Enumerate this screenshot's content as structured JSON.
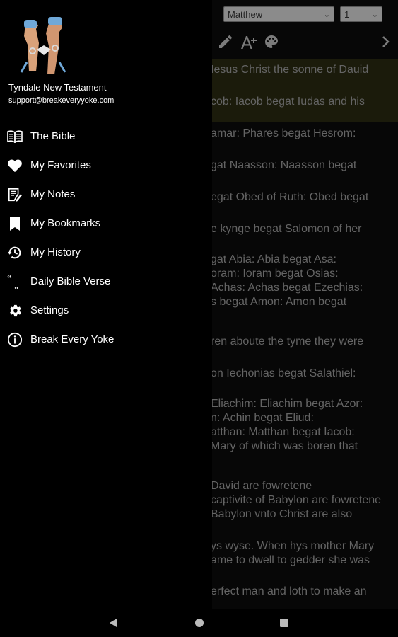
{
  "reader": {
    "book_selected": "Matthew",
    "chapter_selected": "1",
    "verses": [
      {
        "lines": [
          "Iesus Christ the sonne of Dauid"
        ]
      },
      {
        "lines": [
          "cob: Iacob begat Iudas and his"
        ]
      },
      {
        "lines": [
          "amar: Phares begat Hesrom:"
        ]
      },
      {
        "lines": [
          "gat Naasson: Naasson begat"
        ]
      },
      {
        "lines": [
          "egat Obed of Ruth: Obed begat"
        ]
      },
      {
        "lines": [
          "e kynge begat Salomon of her"
        ]
      },
      {
        "lines": [
          "gat Abia: Abia begat Asa:",
          "oram: Ioram begat Osias:",
          "Achas: Achas begat Ezechias:",
          "s begat Amon: Amon begat"
        ]
      },
      {
        "lines": [
          "ren aboute the tyme they were"
        ]
      },
      {
        "lines": [
          "on Iechonias begat Salathiel:"
        ]
      },
      {
        "lines": [
          "Eliachim: Eliachim begat Azor:",
          "n: Achin begat Eliud:",
          "atthan: Matthan begat Iacob:",
          "Mary of which was boren that"
        ]
      },
      {
        "lines": [
          "David are fowretene",
          "captivite of Babylon are fowretene",
          "Babylon vnto Christ are also"
        ]
      },
      {
        "lines": [
          "ys wyse. When hys mother Mary",
          "ame to dwell to gedder she was"
        ]
      },
      {
        "lines": [
          "erfect man and loth to make an"
        ]
      }
    ]
  },
  "drawer": {
    "app_name": "Tyndale New Testament",
    "email": "support@breakeveryyoke.com",
    "menu": [
      {
        "label": "The Bible",
        "icon": "open-book-icon"
      },
      {
        "label": "My Favorites",
        "icon": "heart-icon"
      },
      {
        "label": "My Notes",
        "icon": "notes-icon"
      },
      {
        "label": "My Bookmarks",
        "icon": "bookmark-icon"
      },
      {
        "label": "My History",
        "icon": "history-icon"
      },
      {
        "label": "Daily Bible Verse",
        "icon": "quote-icon"
      },
      {
        "label": "Settings",
        "icon": "gear-icon"
      },
      {
        "label": "Break Every Yoke",
        "icon": "info-icon"
      }
    ]
  }
}
